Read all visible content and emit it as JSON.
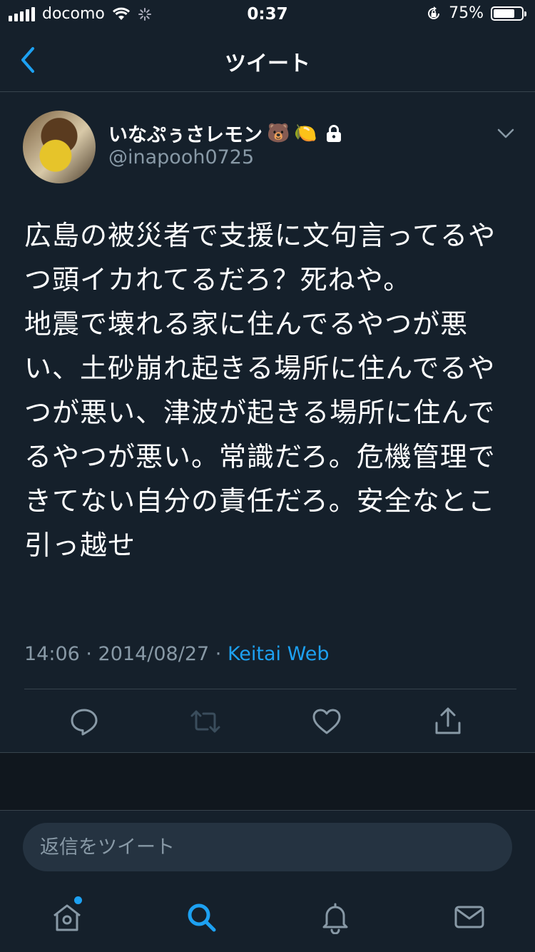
{
  "status_bar": {
    "carrier": "docomo",
    "time": "0:37",
    "battery_percent": 75,
    "battery_label": "75%"
  },
  "nav": {
    "title": "ツイート",
    "back_icon": "chevron-left-icon"
  },
  "tweet": {
    "display_name": "いなぷぅさレモン",
    "name_emojis": [
      "🐻",
      "🍋"
    ],
    "protected_icon": "lock-icon",
    "handle": "@inapooh0725",
    "text": "広島の被災者で支援に文句言ってるやつ頭イカれてるだろ？死ねや。\n地震で壊れる家に住んでるやつが悪い、土砂崩れ起きる場所に住んでるやつが悪い、津波が起きる場所に住んでるやつが悪い。常識だろ。危機管理できてない自分の責任だろ。安全なとこ引っ越せ",
    "timestamp": "14:06 · 2014/08/27 · ",
    "source": "Keitai Web"
  },
  "actions": [
    "reply-icon",
    "retweet-icon",
    "like-icon",
    "share-icon"
  ],
  "reply": {
    "placeholder": "返信をツイート"
  },
  "tabs": [
    "home-icon",
    "search-icon",
    "notifications-icon",
    "messages-icon"
  ],
  "colors": {
    "background": "#15202b",
    "accent": "#1da1f2",
    "secondary_text": "#8899a6",
    "divider": "#38444d"
  }
}
